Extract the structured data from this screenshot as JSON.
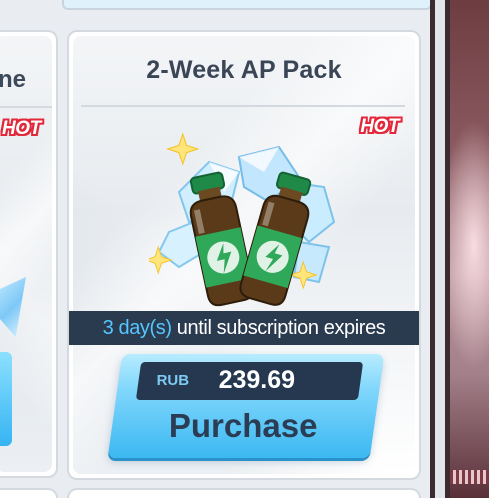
{
  "left_card": {
    "title_fragment": "ne",
    "hot_badge": "HOT"
  },
  "main_card": {
    "title": "2-Week AP Pack",
    "hot_badge": "HOT",
    "item_icon": "ap-potion-bottles-icon",
    "expiry": {
      "days": "3 day(s)",
      "suffix": " until subscription expires"
    },
    "price": {
      "currency": "RUB",
      "amount": "239.69"
    },
    "purchase_label": "Purchase"
  },
  "colors": {
    "hot": "#e2283a",
    "accent_blue": "#3cb8f2",
    "dark_bar": "#2a3a4f",
    "title_text": "#3a4656",
    "bottle_green": "#2fa85a"
  }
}
